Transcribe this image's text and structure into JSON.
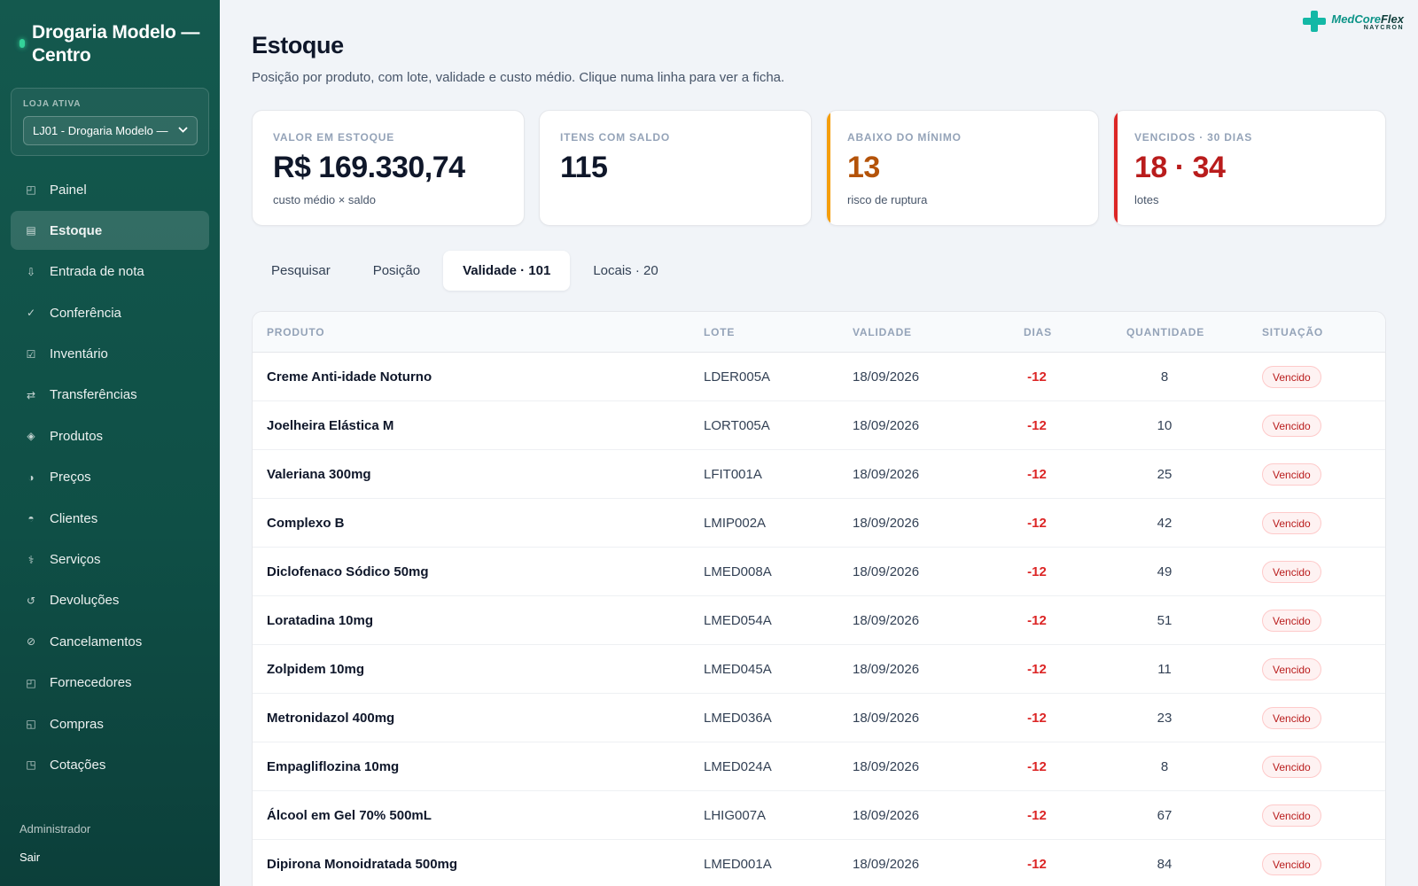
{
  "sidebar": {
    "brand_title": "Drogaria Modelo — Centro",
    "store_label": "LOJA ATIVA",
    "store_value": "LJ01 - Drogaria Modelo —",
    "items": [
      {
        "label": "Painel",
        "icon": "◰"
      },
      {
        "label": "Estoque",
        "icon": "▤"
      },
      {
        "label": "Entrada de nota",
        "icon": "⇩"
      },
      {
        "label": "Conferência",
        "icon": "✓"
      },
      {
        "label": "Inventário",
        "icon": "☑"
      },
      {
        "label": "Transferências",
        "icon": "⇄"
      },
      {
        "label": "Produtos",
        "icon": "◈"
      },
      {
        "label": "Preços",
        "icon": "◑"
      },
      {
        "label": "Clientes",
        "icon": "◓"
      },
      {
        "label": "Serviços",
        "icon": "⚕"
      },
      {
        "label": "Devoluções",
        "icon": "↺"
      },
      {
        "label": "Cancelamentos",
        "icon": "⊘"
      },
      {
        "label": "Fornecedores",
        "icon": "◰"
      },
      {
        "label": "Compras",
        "icon": "◱"
      },
      {
        "label": "Cotações",
        "icon": "◳"
      }
    ],
    "active_item": "Estoque",
    "user_role": "Administrador",
    "logout_label": "Sair"
  },
  "logo": {
    "name_a": "MedCore",
    "name_b": "Flex",
    "sub": "NAYCRON"
  },
  "page": {
    "title": "Estoque",
    "subtitle": "Posição por produto, com lote, validade e custo médio. Clique numa linha para ver a ficha."
  },
  "cards": [
    {
      "label": "VALOR EM ESTOQUE",
      "value": "R$ 169.330,74",
      "note": "custo médio × saldo",
      "accent": "",
      "value_color": "#0f172a"
    },
    {
      "label": "ITENS COM SALDO",
      "value": "115",
      "note": "",
      "accent": "",
      "value_color": "#0f172a"
    },
    {
      "label": "ABAIXO DO MÍNIMO",
      "value": "13",
      "note": "risco de ruptura",
      "accent": "#f59e0b",
      "value_color": "#b45309"
    },
    {
      "label": "VENCIDOS · 30 DIAS",
      "value": "18 · 34",
      "note": "lotes",
      "accent": "#dc2626",
      "value_color": "#b91c1c"
    }
  ],
  "tabs": [
    {
      "label": "Pesquisar",
      "active": false
    },
    {
      "label": "Posição",
      "active": false
    },
    {
      "label": "Validade · 101",
      "active": true
    },
    {
      "label": "Locais · 20",
      "active": false
    }
  ],
  "table": {
    "headers": [
      "PRODUTO",
      "LOTE",
      "VALIDADE",
      "DIAS",
      "QUANTIDADE",
      "SITUAÇÃO"
    ],
    "rows": [
      {
        "produto": "Creme Anti-idade Noturno",
        "lote": "LDER005A",
        "validade": "18/09/2026",
        "dias": "-12",
        "quantidade": "8",
        "situacao": "Vencido"
      },
      {
        "produto": "Joelheira Elástica M",
        "lote": "LORT005A",
        "validade": "18/09/2026",
        "dias": "-12",
        "quantidade": "10",
        "situacao": "Vencido"
      },
      {
        "produto": "Valeriana 300mg",
        "lote": "LFIT001A",
        "validade": "18/09/2026",
        "dias": "-12",
        "quantidade": "25",
        "situacao": "Vencido"
      },
      {
        "produto": "Complexo B",
        "lote": "LMIP002A",
        "validade": "18/09/2026",
        "dias": "-12",
        "quantidade": "42",
        "situacao": "Vencido"
      },
      {
        "produto": "Diclofenaco Sódico 50mg",
        "lote": "LMED008A",
        "validade": "18/09/2026",
        "dias": "-12",
        "quantidade": "49",
        "situacao": "Vencido"
      },
      {
        "produto": "Loratadina 10mg",
        "lote": "LMED054A",
        "validade": "18/09/2026",
        "dias": "-12",
        "quantidade": "51",
        "situacao": "Vencido"
      },
      {
        "produto": "Zolpidem 10mg",
        "lote": "LMED045A",
        "validade": "18/09/2026",
        "dias": "-12",
        "quantidade": "11",
        "situacao": "Vencido"
      },
      {
        "produto": "Metronidazol 400mg",
        "lote": "LMED036A",
        "validade": "18/09/2026",
        "dias": "-12",
        "quantidade": "23",
        "situacao": "Vencido"
      },
      {
        "produto": "Empagliflozina 10mg",
        "lote": "LMED024A",
        "validade": "18/09/2026",
        "dias": "-12",
        "quantidade": "8",
        "situacao": "Vencido"
      },
      {
        "produto": "Álcool em Gel 70% 500mL",
        "lote": "LHIG007A",
        "validade": "18/09/2026",
        "dias": "-12",
        "quantidade": "67",
        "situacao": "Vencido"
      },
      {
        "produto": "Dipirona Monoidratada 500mg",
        "lote": "LMED001A",
        "validade": "18/09/2026",
        "dias": "-12",
        "quantidade": "84",
        "situacao": "Vencido"
      }
    ]
  }
}
